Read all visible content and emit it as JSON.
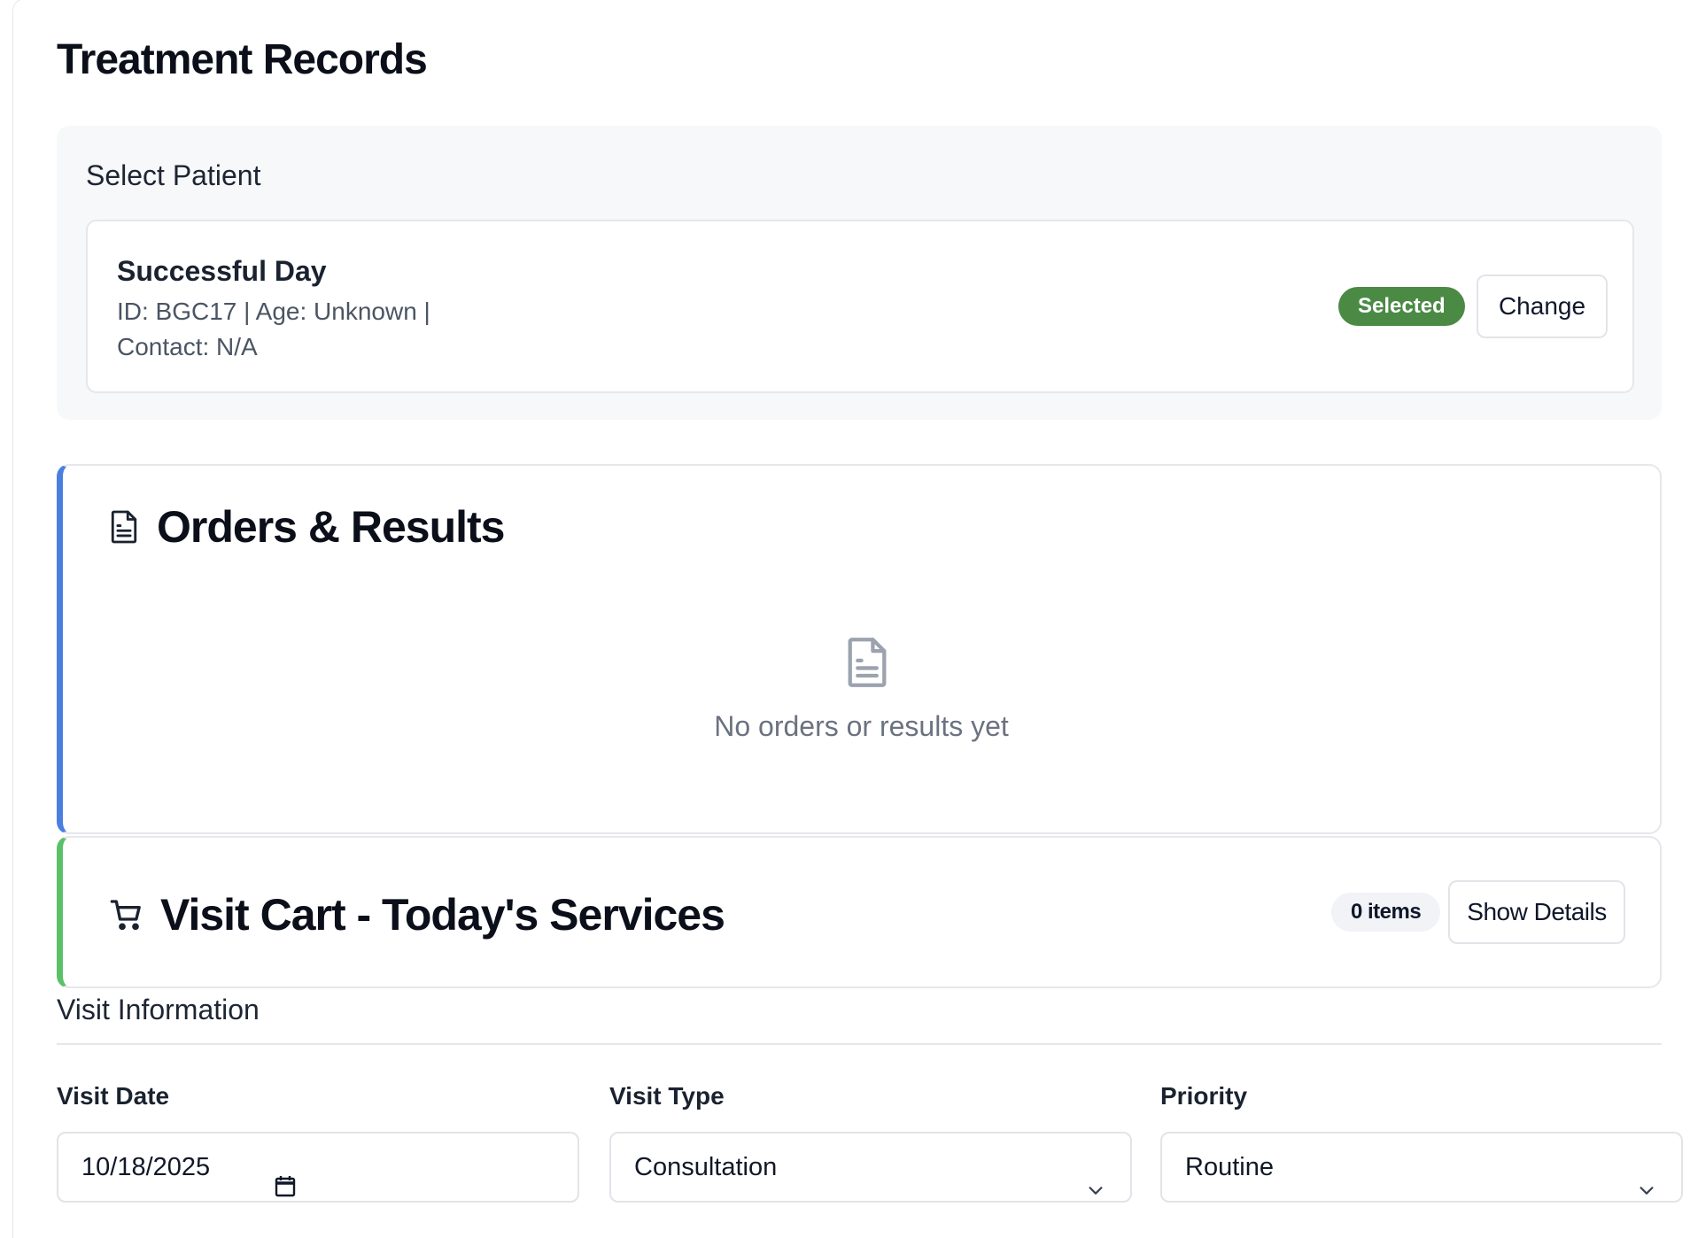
{
  "page": {
    "title": "Treatment Records"
  },
  "patient_panel": {
    "title": "Select Patient",
    "patient": {
      "name": "Successful Day",
      "id_age_line": "ID: BGC17 | Age: Unknown |",
      "contact_line": "Contact: N/A"
    },
    "status_badge": "Selected",
    "change_label": "Change",
    "colors": {
      "badge": "#4a8a45"
    }
  },
  "orders": {
    "title": "Orders & Results",
    "icon": "document-icon",
    "empty_icon": "document-icon",
    "empty_message": "No orders or results yet",
    "accent": "#4a7fe0"
  },
  "cart": {
    "title": "Visit Cart - Today's Services",
    "icon": "cart-icon",
    "items_badge": "0 items",
    "show_details_label": "Show Details",
    "accent": "#5cc06a"
  },
  "visit_info": {
    "title": "Visit Information",
    "fields": [
      {
        "label": "Visit Date",
        "value": "10/18/2025",
        "icon": "calendar-icon"
      },
      {
        "label": "Visit Type",
        "value": "Consultation",
        "icon": "chevron-down-icon"
      },
      {
        "label": "Priority",
        "value": "Routine",
        "icon": "chevron-down-icon"
      }
    ]
  }
}
